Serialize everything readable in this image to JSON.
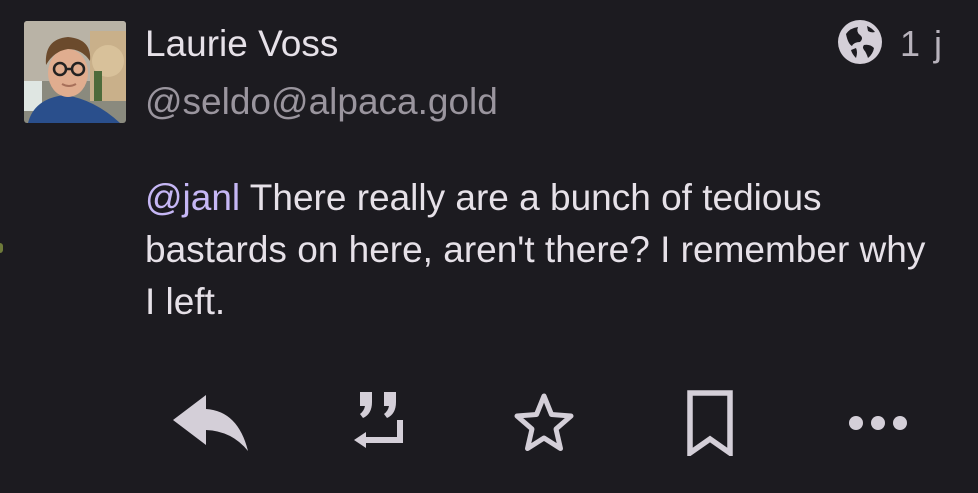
{
  "post": {
    "author": {
      "display_name": "Laurie Voss",
      "handle": "@seldo@alpaca.gold"
    },
    "visibility_icon": "globe-icon",
    "timestamp": "1 j",
    "content": {
      "mention": "@janl",
      "text": " There really are a bunch of tedious bastards on here, aren't there? I remember why I left."
    },
    "actions": [
      {
        "name": "reply",
        "icon": "reply-icon"
      },
      {
        "name": "boost",
        "icon": "boost-icon"
      },
      {
        "name": "favourite",
        "icon": "star-icon"
      },
      {
        "name": "bookmark",
        "icon": "bookmark-icon"
      },
      {
        "name": "more",
        "icon": "more-icon"
      }
    ]
  },
  "colors": {
    "background": "#1c1b20",
    "text": "#e6e1e8",
    "secondary_text": "#9a959e",
    "mention": "#c6b7f5",
    "icon": "#d4cfd8"
  }
}
